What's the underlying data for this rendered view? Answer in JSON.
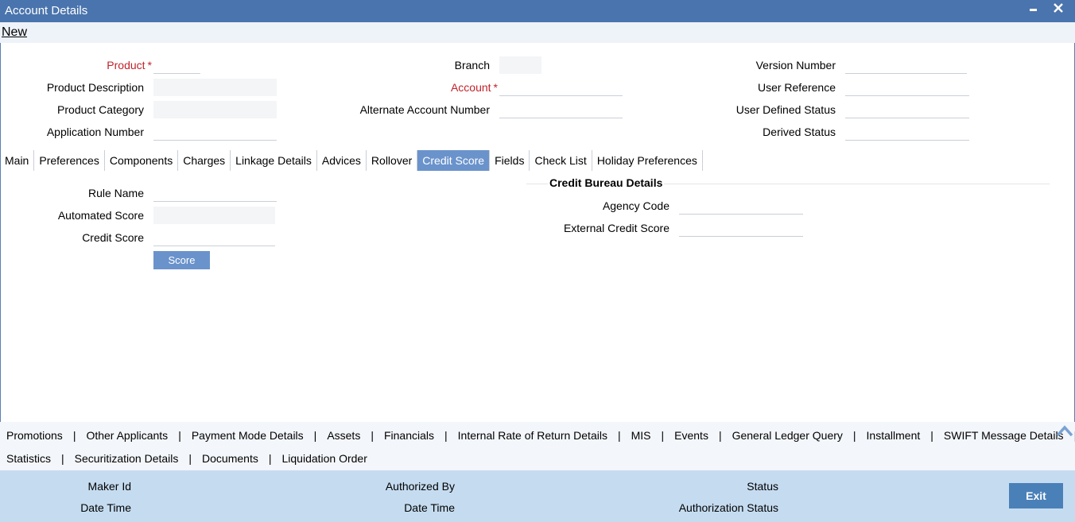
{
  "window": {
    "title": "Account Details",
    "minimize_glyph": "▬",
    "close_glyph": "✕"
  },
  "toolbar": {
    "new_label": "New"
  },
  "header": {
    "product_label": "Product",
    "required_mark": "*",
    "product_description_label": "Product Description",
    "product_category_label": "Product Category",
    "application_number_label": "Application Number",
    "branch_label": "Branch",
    "account_label": "Account",
    "alternate_account_number_label": "Alternate Account Number",
    "version_number_label": "Version Number",
    "user_reference_label": "User Reference",
    "user_defined_status_label": "User Defined Status",
    "derived_status_label": "Derived Status"
  },
  "tabs": [
    "Main",
    "Preferences",
    "Components",
    "Charges",
    "Linkage Details",
    "Advices",
    "Rollover",
    "Credit Score",
    "Fields",
    "Check List",
    "Holiday Preferences"
  ],
  "active_tab": "Credit Score",
  "credit_score": {
    "rule_name_label": "Rule Name",
    "automated_score_label": "Automated Score",
    "credit_score_label": "Credit Score",
    "score_button": "Score",
    "bureau_title": "Credit Bureau Details",
    "agency_code_label": "Agency Code",
    "external_credit_score_label": "External Credit Score"
  },
  "subsystems": {
    "row1": [
      "Promotions",
      "Other Applicants",
      "Payment Mode Details",
      "Assets",
      "Financials",
      "Internal Rate of Return Details",
      "MIS",
      "Events",
      "General Ledger Query",
      "Installment",
      "SWIFT Message Details"
    ],
    "row2": [
      "Statistics",
      "Securitization Details",
      "Documents",
      "Liquidation Order"
    ],
    "separator": "|"
  },
  "footer": {
    "maker_id_label": "Maker Id",
    "maker_date_time_label": "Date Time",
    "authorized_by_label": "Authorized By",
    "checker_date_time_label": "Date Time",
    "status_label": "Status",
    "authorization_status_label": "Authorization Status",
    "exit_button": "Exit"
  },
  "colors": {
    "titlebar": "#4a74ad",
    "active_tab": "#6a93cc",
    "required": "#c0232b",
    "footer": "#c5dcf0",
    "exit_button": "#4a80b8"
  }
}
